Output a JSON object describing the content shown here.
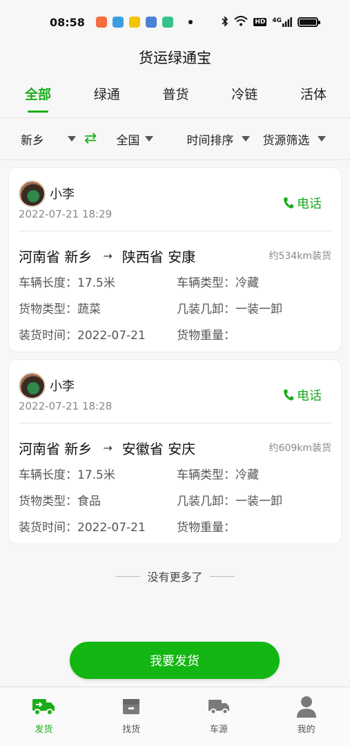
{
  "status_bar": {
    "time": "08:58",
    "icons": [
      "bluetooth-icon",
      "wifi-icon",
      "hd-icon",
      "signal-4g-icon",
      "battery-icon"
    ],
    "net_badge": "HD",
    "net_type": "4G"
  },
  "app": {
    "title": "货运绿通宝"
  },
  "tabs": [
    {
      "label": "全部",
      "active": true
    },
    {
      "label": "绿通",
      "active": false
    },
    {
      "label": "普货",
      "active": false
    },
    {
      "label": "冷链",
      "active": false
    },
    {
      "label": "活体",
      "active": false
    }
  ],
  "filters": {
    "origin": "新乡",
    "destination": "全国",
    "sort": "时间排序",
    "cargo_filter": "货源筛选"
  },
  "colors": {
    "accent": "#1aad19",
    "cta": "#13b613"
  },
  "listings": [
    {
      "user": "小李",
      "time": "2022-07-21 18:29",
      "call_label": "电话",
      "from": "河南省 新乡",
      "to": "陕西省 安康",
      "distance": "约534km装货",
      "vehicle_length_label": "车辆长度：",
      "vehicle_length": "17.5米",
      "vehicle_type_label": "车辆类型：",
      "vehicle_type": "冷藏",
      "cargo_type_label": "货物类型：",
      "cargo_type": "蔬菜",
      "load_unload_label": "几装几卸：",
      "load_unload": "一装一卸",
      "load_time_label": "装货时间：",
      "load_time": "2022-07-21",
      "weight_label": "货物重量：",
      "weight": ""
    },
    {
      "user": "小李",
      "time": "2022-07-21 18:28",
      "call_label": "电话",
      "from": "河南省 新乡",
      "to": "安徽省 安庆",
      "distance": "约609km装货",
      "vehicle_length_label": "车辆长度：",
      "vehicle_length": "17.5米",
      "vehicle_type_label": "车辆类型：",
      "vehicle_type": "冷藏",
      "cargo_type_label": "货物类型：",
      "cargo_type": "食品",
      "load_unload_label": "几装几卸：",
      "load_unload": "一装一卸",
      "load_time_label": "装货时间：",
      "load_time": "2022-07-21",
      "weight_label": "货物重量：",
      "weight": ""
    }
  ],
  "end_text": "没有更多了",
  "cta_label": "我要发货",
  "bottom_nav": [
    {
      "label": "发货",
      "icon": "ship-truck-icon",
      "active": true
    },
    {
      "label": "找货",
      "icon": "cargo-box-icon",
      "active": false
    },
    {
      "label": "车源",
      "icon": "truck-icon",
      "active": false
    },
    {
      "label": "我的",
      "icon": "profile-icon",
      "active": false
    }
  ]
}
